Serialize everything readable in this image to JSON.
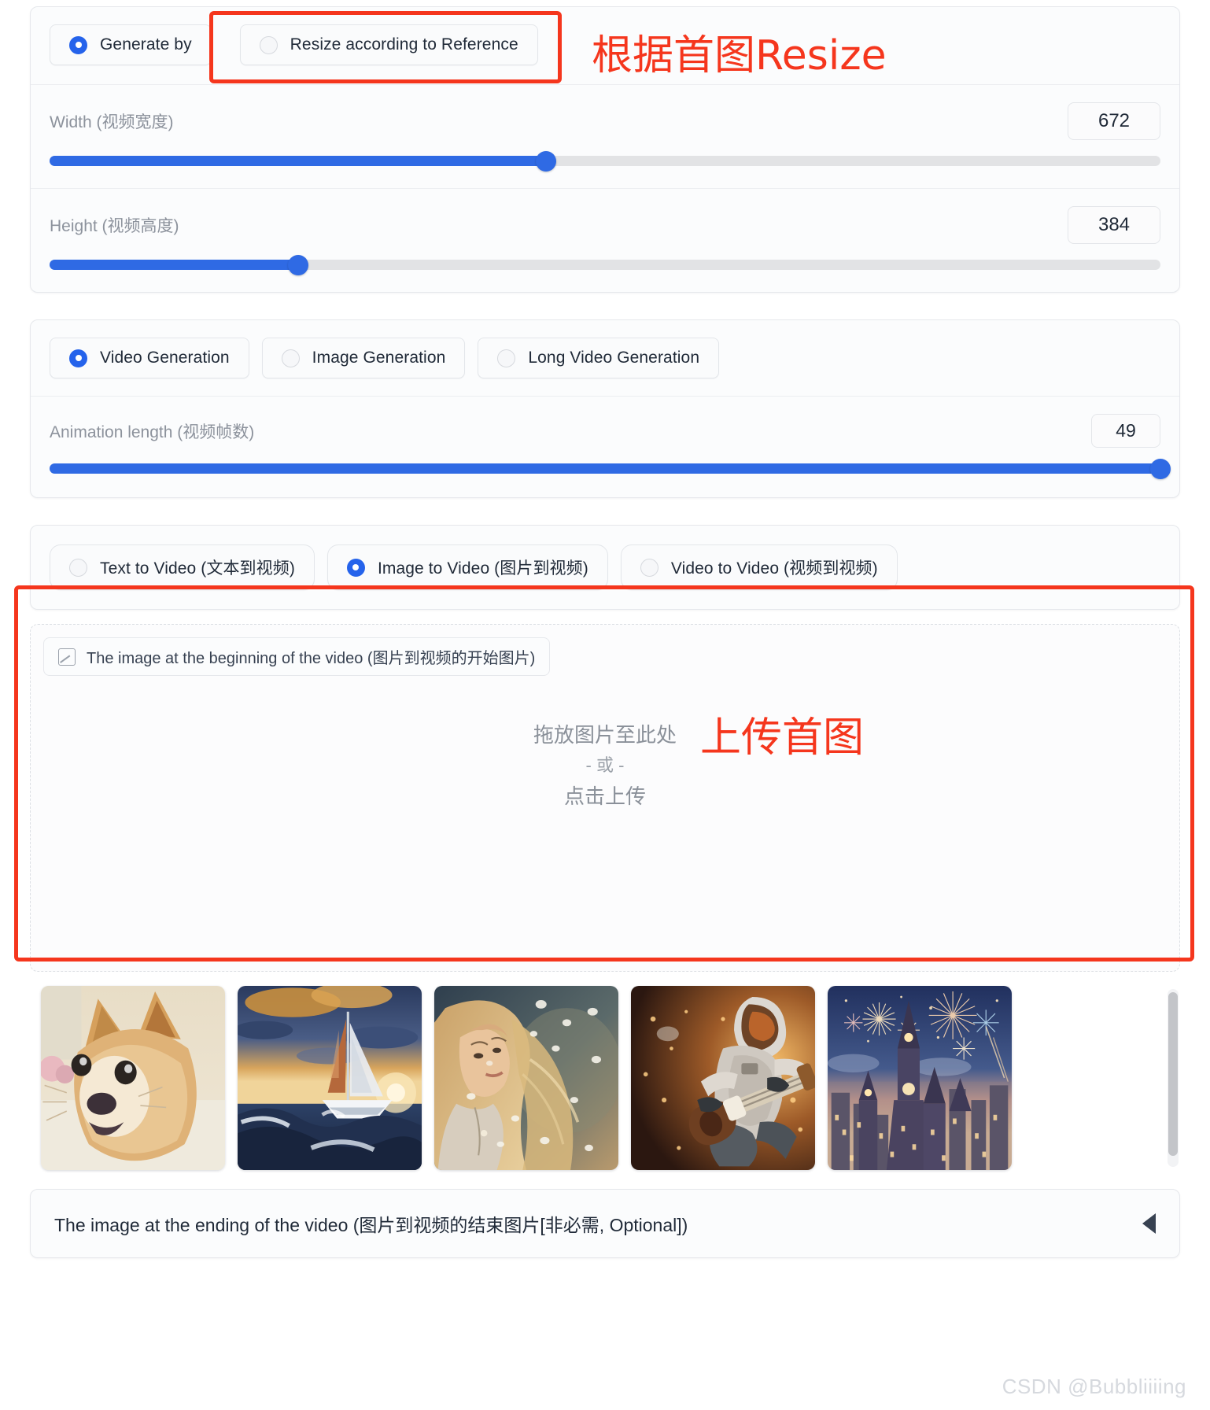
{
  "resize_section": {
    "options": [
      {
        "label": "Generate by",
        "selected": true
      },
      {
        "label": "Resize according to Reference",
        "selected": false
      }
    ],
    "annotation": "根据首图Resize",
    "width": {
      "label": "Width (视频宽度)",
      "value": "672",
      "fill_percent": 44.7
    },
    "height": {
      "label": "Height (视频高度)",
      "value": "384",
      "fill_percent": 22.4
    }
  },
  "generation_section": {
    "options": [
      {
        "label": "Video Generation",
        "selected": true
      },
      {
        "label": "Image Generation",
        "selected": false
      },
      {
        "label": "Long Video Generation",
        "selected": false
      }
    ],
    "animation_length": {
      "label": "Animation length (视频帧数)",
      "value": "49",
      "fill_percent": 100
    }
  },
  "mode_section": {
    "options": [
      {
        "label": "Text to Video (文本到视频)",
        "selected": false
      },
      {
        "label": "Image to Video (图片到视频)",
        "selected": true
      },
      {
        "label": "Video to Video (视频到视频)",
        "selected": false
      }
    ]
  },
  "upload_section": {
    "tag_label": "The image at the beginning of the video (图片到视频的开始图片)",
    "tag_icon": "image-icon",
    "drop_line1": "拖放图片至此处",
    "drop_line2": "- 或 -",
    "drop_line3": "点击上传",
    "annotation": "上传首图"
  },
  "gallery": {
    "items": [
      {
        "name": "doge-shiba-inu"
      },
      {
        "name": "sailboat-sunset-ocean"
      },
      {
        "name": "blonde-woman-petals"
      },
      {
        "name": "astronaut-guitarist"
      },
      {
        "name": "fireworks-castle-city"
      }
    ]
  },
  "ending_section": {
    "title": "The image at the ending of the video (图片到视频的结束图片[非必需, Optional])",
    "caret_icon": "caret-left-icon"
  },
  "watermark": "CSDN @Bubbliiiing",
  "colors": {
    "accent_blue": "#2f6ae4",
    "annotation_red": "#f5361d",
    "panel_bg": "#fbfcfd",
    "border": "#e6e8ec"
  }
}
